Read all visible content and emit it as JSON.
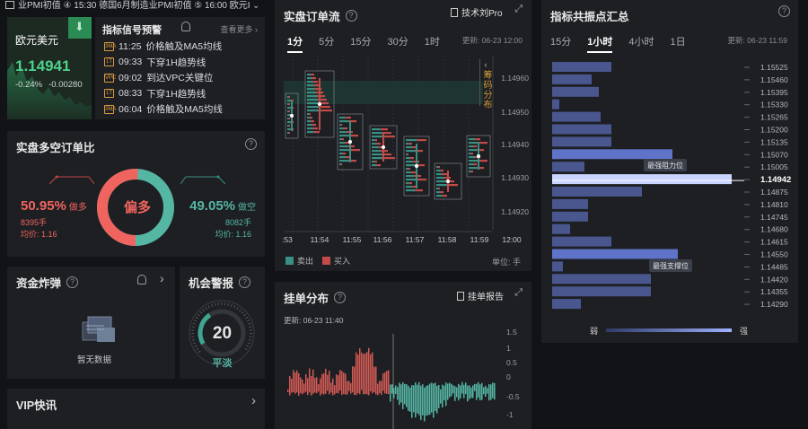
{
  "ticker": {
    "text": "业PMI初值 ④ 15:30 德国6月制造业PMI初值 ⑤ 16:00 欧元I"
  },
  "eurusd": {
    "name": "欧元美元",
    "price": "1.14941",
    "change_pct": "-0.24%",
    "change_abs": "-0.00280"
  },
  "signals": {
    "title": "指标信号预警",
    "more": "查看更多",
    "items": [
      {
        "badge": "3MA",
        "time": "11:25",
        "text": "价格触及MA5均线"
      },
      {
        "badge": "1T",
        "time": "09:33",
        "text": "下穿1H趋势线"
      },
      {
        "badge": "VPC",
        "time": "09:02",
        "text": "到达VPC关键位"
      },
      {
        "badge": "1T",
        "time": "08:33",
        "text": "下穿1H趋势线"
      },
      {
        "badge": "3MA",
        "time": "06:04",
        "text": "价格触及MA5均线"
      }
    ]
  },
  "ratio": {
    "title": "实盘多空订单比",
    "center": "偏多",
    "long_pct": "50.95%",
    "long_label": "做多",
    "long_lots": "8395手",
    "long_avg": "均价: 1.16",
    "short_pct": "49.05%",
    "short_label": "做空",
    "short_lots": "8082手",
    "short_avg": "均价: 1.16",
    "long_value": 50.95,
    "short_value": 49.05,
    "long_color": "#f0645f",
    "short_color": "#55b6a4"
  },
  "fund": {
    "title": "资金炸弹",
    "empty": "暂无数据"
  },
  "alert": {
    "title": "机会警报",
    "value": "20",
    "label": "平淡",
    "level": 20
  },
  "vip": {
    "title": "VIP快讯"
  },
  "orderflow": {
    "title": "实盘订单流",
    "link": "技术刘Pro",
    "tabs": [
      "1分",
      "5分",
      "15分",
      "30分",
      "1时"
    ],
    "active_tab": 0,
    "updated": "更新: 06-23 12:00",
    "y_ticks": [
      "1.14960",
      "1.14950",
      "1.14940",
      "1.14930",
      "1.14920"
    ],
    "x_ticks": [
      ":53",
      "11:54",
      "11:55",
      "11:56",
      "11:57",
      "11:58",
      "11:59",
      "12:00"
    ],
    "side_label": "筹码分布",
    "legend_sell": "卖出",
    "legend_buy": "买入",
    "unit": "单位: 手",
    "sell_color": "#3a8f83",
    "buy_color": "#c44a47"
  },
  "depth": {
    "title": "挂单分布",
    "link": "挂单报告",
    "updated": "更新: 06-23 11:40",
    "y_ticks": [
      "1.5",
      "1",
      "0.5",
      "0",
      "-0.5",
      "-1"
    ]
  },
  "pivot": {
    "title": "指标共振点汇总",
    "tabs": [
      "15分",
      "1小时",
      "4小时",
      "1日"
    ],
    "active_tab": 1,
    "updated": "更新: 06-23 11:59",
    "levels": [
      "1.15525",
      "1.15460",
      "1.15395",
      "1.15330",
      "1.15265",
      "1.15200",
      "1.15135",
      "1.15070",
      "1.15005",
      "1.14942",
      "1.14875",
      "1.14810",
      "1.14745",
      "1.14680",
      "1.14615",
      "1.14550",
      "1.14485",
      "1.14420",
      "1.14355",
      "1.14290"
    ],
    "current_level": "1.14942",
    "resist_label": "最强阻力位",
    "support_label": "最强支撑位",
    "weak": "弱",
    "strong": "强",
    "strengths": [
      0.33,
      0.22,
      0.26,
      0.04,
      0.27,
      0.33,
      0.33,
      0.67,
      0.18,
      1.0,
      0.5,
      0.2,
      0.2,
      0.1,
      0.33,
      0.7,
      0.06,
      0.55,
      0.55,
      0.16
    ]
  }
}
